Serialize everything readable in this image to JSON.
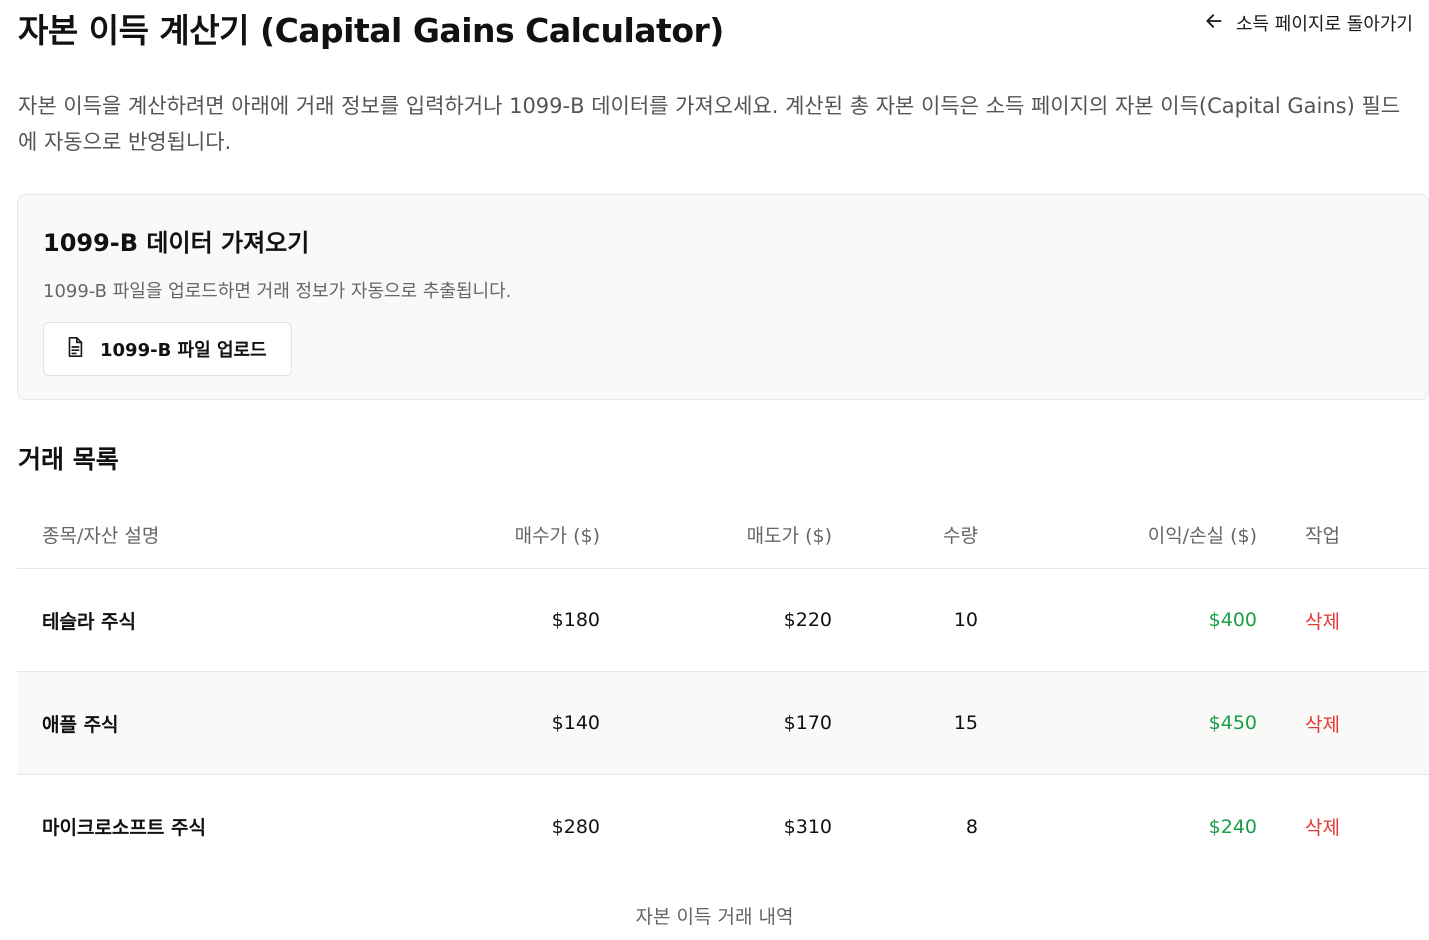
{
  "header": {
    "title": "자본 이득 계산기 (Capital Gains Calculator)",
    "back_label": "소득 페이지로 돌아가기"
  },
  "description": "자본 이득을 계산하려면 아래에 거래 정보를 입력하거나 1099-B 데이터를 가져오세요. 계산된 총 자본 이득은 소득 페이지의 자본 이득(Capital Gains) 필드에 자동으로 반영됩니다.",
  "import_card": {
    "title": "1099-B 데이터 가져오기",
    "subtitle": "1099-B 파일을 업로드하면 거래 정보가 자동으로 추출됩니다.",
    "upload_label": "1099-B 파일 업로드"
  },
  "transactions": {
    "title": "거래 목록",
    "columns": {
      "name": "종목/자산 설명",
      "buy": "매수가 ($)",
      "sell": "매도가 ($)",
      "qty": "수량",
      "gain": "이익/손실 ($)",
      "action": "작업"
    },
    "rows": [
      {
        "name": "테슬라 주식",
        "buy": "$180",
        "sell": "$220",
        "qty": "10",
        "gain": "$400",
        "action": "삭제"
      },
      {
        "name": "애플 주식",
        "buy": "$140",
        "sell": "$170",
        "qty": "15",
        "gain": "$450",
        "action": "삭제"
      },
      {
        "name": "마이크로소프트 주식",
        "buy": "$280",
        "sell": "$310",
        "qty": "8",
        "gain": "$240",
        "action": "삭제"
      }
    ],
    "caption": "자본 이득 거래 내역"
  },
  "colors": {
    "gain_positive": "#1a9e4a",
    "delete": "#e53935"
  },
  "icons": {
    "back": "arrow-left-icon",
    "upload": "file-text-icon"
  }
}
